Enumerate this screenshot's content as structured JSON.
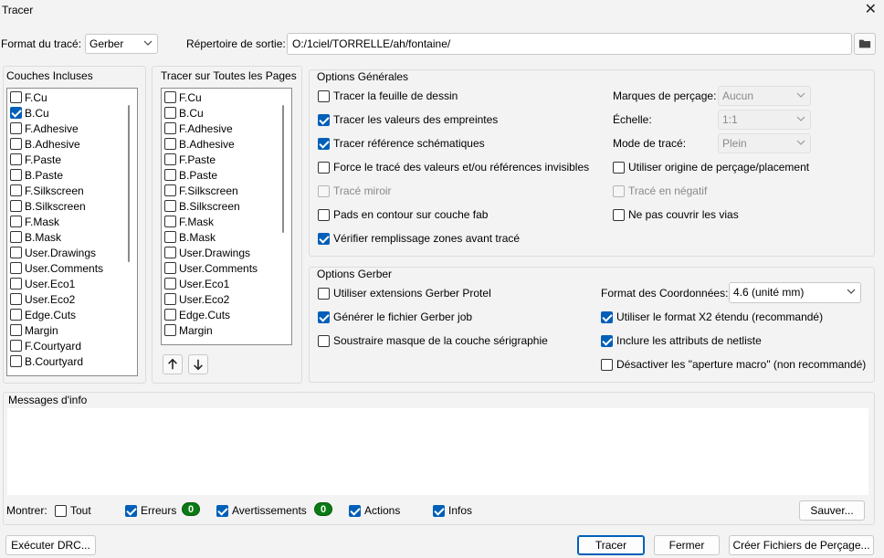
{
  "window": {
    "title": "Tracer"
  },
  "top": {
    "format_label": "Format du tracé:",
    "format_value": "Gerber",
    "outdir_label": "Répertoire de sortie:",
    "outdir_value": "O:/1ciel/TORRELLE/ah/fontaine/"
  },
  "layers_included": {
    "title": "Couches Incluses",
    "items": [
      {
        "label": "F.Cu",
        "checked": false
      },
      {
        "label": "B.Cu",
        "checked": true
      },
      {
        "label": "F.Adhesive",
        "checked": false
      },
      {
        "label": "B.Adhesive",
        "checked": false
      },
      {
        "label": "F.Paste",
        "checked": false
      },
      {
        "label": "B.Paste",
        "checked": false
      },
      {
        "label": "F.Silkscreen",
        "checked": false
      },
      {
        "label": "B.Silkscreen",
        "checked": false
      },
      {
        "label": "F.Mask",
        "checked": false
      },
      {
        "label": "B.Mask",
        "checked": false
      },
      {
        "label": "User.Drawings",
        "checked": false
      },
      {
        "label": "User.Comments",
        "checked": false
      },
      {
        "label": "User.Eco1",
        "checked": false
      },
      {
        "label": "User.Eco2",
        "checked": false
      },
      {
        "label": "Edge.Cuts",
        "checked": false
      },
      {
        "label": "Margin",
        "checked": false
      },
      {
        "label": "F.Courtyard",
        "checked": false
      },
      {
        "label": "B.Courtyard",
        "checked": false
      }
    ]
  },
  "layers_all_pages": {
    "title": "Tracer sur Toutes les Pages",
    "items": [
      {
        "label": "F.Cu",
        "checked": false
      },
      {
        "label": "B.Cu",
        "checked": false
      },
      {
        "label": "F.Adhesive",
        "checked": false
      },
      {
        "label": "B.Adhesive",
        "checked": false
      },
      {
        "label": "F.Paste",
        "checked": false
      },
      {
        "label": "B.Paste",
        "checked": false
      },
      {
        "label": "F.Silkscreen",
        "checked": false
      },
      {
        "label": "B.Silkscreen",
        "checked": false
      },
      {
        "label": "F.Mask",
        "checked": false
      },
      {
        "label": "B.Mask",
        "checked": false
      },
      {
        "label": "User.Drawings",
        "checked": false
      },
      {
        "label": "User.Comments",
        "checked": false
      },
      {
        "label": "User.Eco1",
        "checked": false
      },
      {
        "label": "User.Eco2",
        "checked": false
      },
      {
        "label": "Edge.Cuts",
        "checked": false
      },
      {
        "label": "Margin",
        "checked": false
      }
    ]
  },
  "general": {
    "title": "Options Générales",
    "options": [
      {
        "label": "Tracer la feuille de dessin",
        "checked": false,
        "disabled": false
      },
      {
        "label": "Tracer les valeurs des empreintes",
        "checked": true,
        "disabled": false
      },
      {
        "label": "Tracer référence  schématiques",
        "checked": true,
        "disabled": false
      },
      {
        "label": "Force le tracé des valeurs et/ou références invisibles",
        "checked": false,
        "disabled": false
      },
      {
        "label": "Tracé miroir",
        "checked": false,
        "disabled": true
      },
      {
        "label": "Pads en contour sur couche fab",
        "checked": false,
        "disabled": false
      },
      {
        "label": "Vérifier remplissage zones avant tracé",
        "checked": true,
        "disabled": false
      }
    ],
    "drill_marks_label": "Marques de perçage:",
    "drill_marks_value": "Aucun",
    "scale_label": "Échelle:",
    "scale_value": "1:1",
    "plot_mode_label": "Mode de tracé:",
    "plot_mode_value": "Plein",
    "right_options": [
      {
        "label": "Utiliser origine de perçage/placement",
        "checked": false,
        "disabled": false
      },
      {
        "label": "Tracé en négatif",
        "checked": false,
        "disabled": true
      },
      {
        "label": "Ne pas couvrir les vias",
        "checked": false,
        "disabled": false
      }
    ]
  },
  "gerber": {
    "title": "Options Gerber",
    "options": [
      {
        "label": "Utiliser extensions Gerber Protel",
        "checked": false
      },
      {
        "label": "Générer le fichier Gerber job",
        "checked": true
      },
      {
        "label": "Soustraire masque de la couche sérigraphie",
        "checked": false
      }
    ],
    "coord_label": "Format des Coordonnées:",
    "coord_value": "4.6 (unité mm)",
    "right_options": [
      {
        "label": "Utiliser le format X2 étendu (recommandé)",
        "checked": true
      },
      {
        "label": "Inclure les attributs de netliste",
        "checked": true
      },
      {
        "label": "Désactiver les \"aperture macro\" (non recommandé)",
        "checked": false
      }
    ]
  },
  "messages": {
    "title": "Messages d'info",
    "show_label": "Montrer:",
    "filters": [
      {
        "label": "Tout",
        "checked": false
      },
      {
        "label": "Erreurs",
        "checked": true,
        "count": "0"
      },
      {
        "label": "Avertissements",
        "checked": true,
        "count": "0"
      },
      {
        "label": "Actions",
        "checked": true
      },
      {
        "label": "Infos",
        "checked": true
      }
    ],
    "save_label": "Sauver..."
  },
  "footer": {
    "drc_label": "Exécuter DRC...",
    "plot_label": "Tracer",
    "close_label": "Fermer",
    "drill_label": "Créer Fichiers de Perçage..."
  }
}
